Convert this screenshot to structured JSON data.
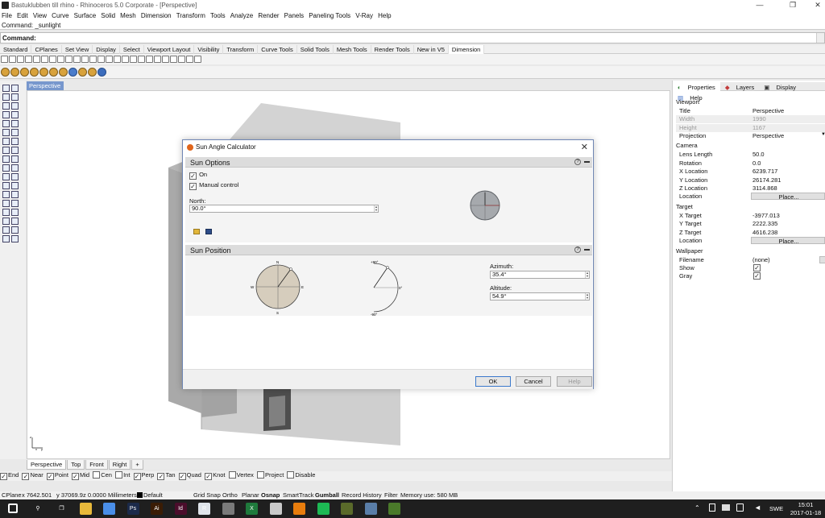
{
  "window": {
    "title": "Bastuklubben till rhino - Rhinoceros  5.0 Corporate - [Perspective]",
    "controls": [
      "—",
      "❐",
      "✕"
    ]
  },
  "menu": [
    "File",
    "Edit",
    "View",
    "Curve",
    "Surface",
    "Solid",
    "Mesh",
    "Dimension",
    "Transform",
    "Tools",
    "Analyze",
    "Render",
    "Panels",
    "Paneling Tools",
    "V-Ray",
    "Help"
  ],
  "command_history": "Command: _sunlight",
  "command_prompt": "Command:",
  "toolbar_tabs": [
    "Standard",
    "CPlanes",
    "Set View",
    "Display",
    "Select",
    "Viewport Layout",
    "Visibility",
    "Transform",
    "Curve Tools",
    "Solid Tools",
    "Mesh Tools",
    "Render Tools",
    "New in V5",
    "Dimension"
  ],
  "active_toolbar_tab": "Dimension",
  "viewport": {
    "active_tab": "Perspective",
    "bottom_tabs": [
      "Perspective",
      "Top",
      "Front",
      "Right"
    ],
    "add_tab": "+"
  },
  "osnap": [
    {
      "label": "End",
      "checked": true
    },
    {
      "label": "Near",
      "checked": true
    },
    {
      "label": "Point",
      "checked": true
    },
    {
      "label": "Mid",
      "checked": true
    },
    {
      "label": "Cen",
      "checked": false
    },
    {
      "label": "Int",
      "checked": false
    },
    {
      "label": "Perp",
      "checked": true
    },
    {
      "label": "Tan",
      "checked": true
    },
    {
      "label": "Quad",
      "checked": true
    },
    {
      "label": "Knot",
      "checked": true
    },
    {
      "label": "Vertex",
      "checked": false
    },
    {
      "label": "Project",
      "checked": false
    },
    {
      "label": "Disable",
      "checked": false
    }
  ],
  "status": {
    "cplane": "CPlane",
    "x": "x 7642.501",
    "y": "y 37069.9",
    "z": "z 0.0000",
    "units": "Millimeters",
    "layer": "Default",
    "toggles": [
      "Grid Snap",
      "Ortho",
      "Planar",
      "Osnap",
      "SmartTrack",
      "Gumball",
      "Record History",
      "Filter"
    ],
    "memory": "Memory use: 580 MB"
  },
  "taskbar": {
    "time": "15:01",
    "date": "2017-01-18",
    "lang": "SWE",
    "icons": [
      "windows-icon",
      "search-icon",
      "task-view-icon",
      "explorer-icon",
      "chrome-icon",
      "photoshop-icon",
      "illustrator-icon",
      "indesign-icon",
      "rhino-icon",
      "sunlight-app-icon",
      "excel-icon",
      "calculator-icon",
      "vlc-icon",
      "spotify-icon",
      "sketch-icon",
      "notes-icon",
      "minecraft-icon"
    ],
    "icon_colors": [
      "#1f1f1f",
      "#1f1f1f",
      "#1f1f1f",
      "#e8b93b",
      "#4a8ee8",
      "#1b2a4a",
      "#3a1c05",
      "#4b0d2b",
      "#dfe4ea",
      "#7a7a7a",
      "#1f7a3c",
      "#c9c9c9",
      "#e87d0d",
      "#1db954",
      "#5a6a2a",
      "#5a7ea8",
      "#4a7a2a"
    ],
    "icon_labels": [
      "",
      "⚲",
      "❐",
      "",
      "",
      "Ps",
      "Ai",
      "Id",
      "R",
      "",
      "X",
      "",
      "",
      "",
      "",
      "",
      ""
    ]
  },
  "properties": {
    "tabs": [
      "Properties",
      "Layers",
      "Display",
      "Help"
    ],
    "sections": {
      "viewport": "Viewport",
      "camera": "Camera",
      "target": "Target",
      "wallpaper": "Wallpaper"
    },
    "viewport_rows": [
      {
        "label": "Title",
        "value": "Perspective",
        "dim": false
      },
      {
        "label": "Width",
        "value": "1990",
        "dim": true
      },
      {
        "label": "Height",
        "value": "1167",
        "dim": true
      },
      {
        "label": "Projection",
        "value": "Perspective",
        "dim": false
      }
    ],
    "camera_rows": [
      {
        "label": "Lens Length",
        "value": "50.0"
      },
      {
        "label": "Rotation",
        "value": "0.0"
      },
      {
        "label": "X Location",
        "value": "6239.717"
      },
      {
        "label": "Y Location",
        "value": "26174.281"
      },
      {
        "label": "Z Location",
        "value": "3114.868"
      },
      {
        "label": "Location",
        "value": "Place..."
      }
    ],
    "target_rows": [
      {
        "label": "X Target",
        "value": "-3977.013"
      },
      {
        "label": "Y Target",
        "value": "2222.335"
      },
      {
        "label": "Z Target",
        "value": "4616.238"
      },
      {
        "label": "Location",
        "value": "Place..."
      }
    ],
    "wallpaper_rows": [
      {
        "label": "Filename",
        "value": "(none)"
      },
      {
        "label": "Show",
        "value": "✓"
      },
      {
        "label": "Gray",
        "value": "✓"
      }
    ]
  },
  "dialog": {
    "title": "Sun Angle Calculator",
    "sun_options": {
      "header": "Sun Options",
      "on_label": "On",
      "on_checked": true,
      "manual_label": "Manual control",
      "manual_checked": true,
      "north_label": "North:",
      "north_value": "90.0°"
    },
    "sun_position": {
      "header": "Sun Position",
      "compass": {
        "n": "N",
        "e": "E",
        "s": "S",
        "w": "W"
      },
      "altitude_marks": {
        "top": "+90°",
        "mid": "0°",
        "bottom": "-90°"
      },
      "azimuth_label": "Azimuth:",
      "azimuth_value": "35.4°",
      "altitude_label": "Altitude:",
      "altitude_value": "54.9°"
    },
    "buttons": {
      "ok": "OK",
      "cancel": "Cancel",
      "help": "Help"
    }
  }
}
